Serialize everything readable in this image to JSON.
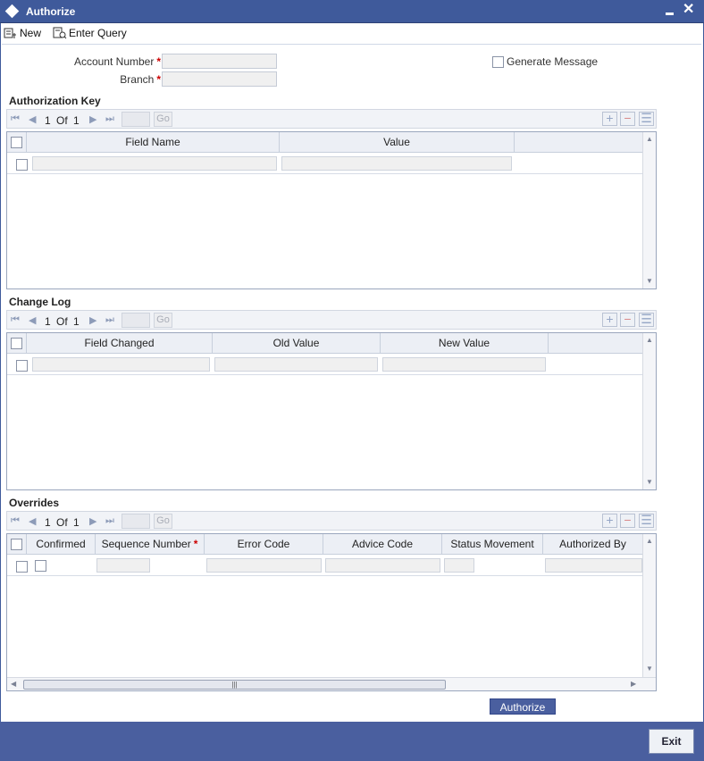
{
  "window": {
    "title": "Authorize"
  },
  "toolbar": {
    "new_label": "New",
    "enter_query_label": "Enter Query"
  },
  "form": {
    "account_number_label": "Account Number",
    "branch_label": "Branch",
    "required_mark": "*",
    "generate_message_label": "Generate Message"
  },
  "authorization_key": {
    "title": "Authorization Key",
    "page_current": "1",
    "page_of": "Of",
    "page_total": "1",
    "go_label": "Go",
    "columns": [
      "Field Name",
      "Value"
    ]
  },
  "change_log": {
    "title": "Change Log",
    "page_current": "1",
    "page_of": "Of",
    "page_total": "1",
    "go_label": "Go",
    "columns": [
      "Field Changed",
      "Old Value",
      "New Value"
    ]
  },
  "overrides": {
    "title": "Overrides",
    "page_current": "1",
    "page_of": "Of",
    "page_total": "1",
    "go_label": "Go",
    "columns": [
      "Confirmed",
      "Sequence Number",
      "Error Code",
      "Advice Code",
      "Status Movement",
      "Authorized By"
    ],
    "required_mark": "*"
  },
  "buttons": {
    "authorize_label": "Authorize",
    "exit_label": "Exit"
  },
  "icons": {
    "first": "⏮",
    "prev": "◀",
    "next": "▶",
    "last": "⏭",
    "add": "+",
    "delete": "−",
    "list": "☰",
    "close": "✕",
    "scroll_up": "▲",
    "scroll_down": "▼",
    "scroll_left": "◀",
    "scroll_right": "▶",
    "grip": "|||"
  },
  "colors": {
    "brand": "#3f5a9b",
    "footer": "#4a5f9f",
    "required": "#c00000"
  }
}
